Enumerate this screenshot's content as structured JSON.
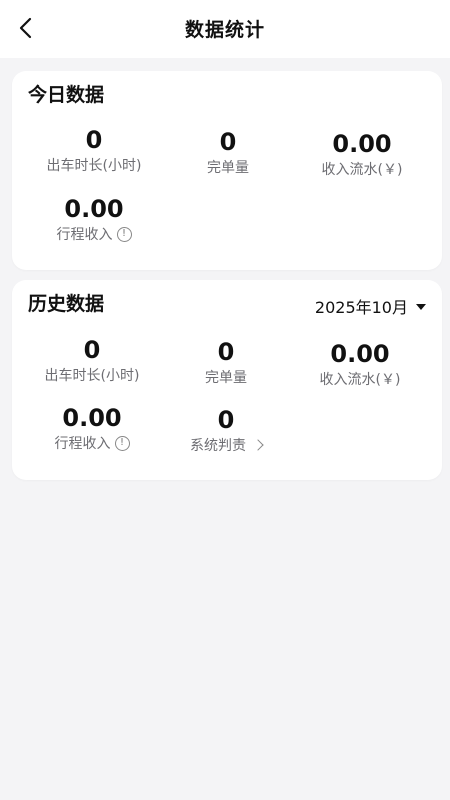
{
  "header": {
    "title": "数据统计"
  },
  "today": {
    "title": "今日数据",
    "stats": [
      {
        "value": "0",
        "label": "出车时长(小时)"
      },
      {
        "value": "0",
        "label": "完单量"
      },
      {
        "value": "0.00",
        "label": "收入流水(￥)"
      },
      {
        "value": "0.00",
        "label": "行程收入"
      }
    ]
  },
  "history": {
    "title": "历史数据",
    "month": "2025年10月",
    "stats": [
      {
        "value": "0",
        "label": "出车时长(小时)"
      },
      {
        "value": "0",
        "label": "完单量"
      },
      {
        "value": "0.00",
        "label": "收入流水(￥)"
      },
      {
        "value": "0.00",
        "label": "行程收入"
      },
      {
        "value": "0",
        "label": "系统判责"
      }
    ]
  }
}
